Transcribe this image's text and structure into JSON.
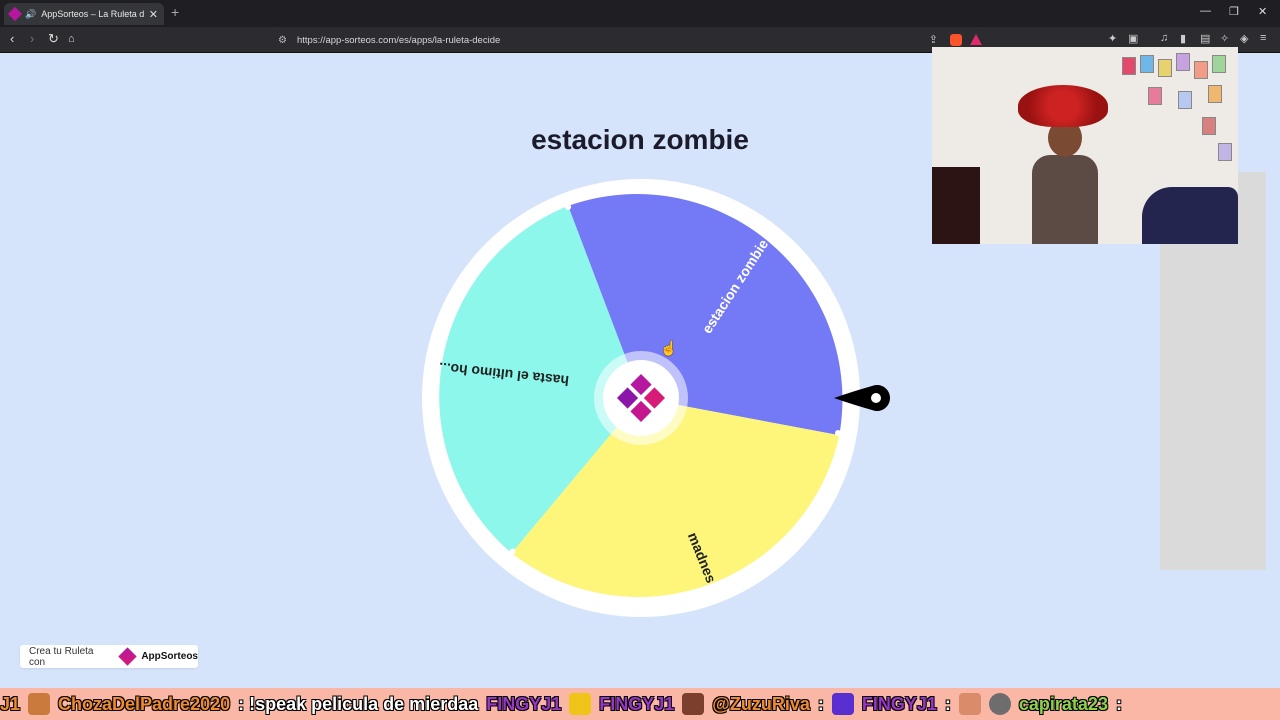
{
  "browser": {
    "tab_title": "AppSorteos – La Ruleta de la",
    "tab_audio_icon": "speaker-icon",
    "url": "https://app-sorteos.com/es/apps/la-ruleta-decide"
  },
  "page": {
    "title": "estacion zombie"
  },
  "wheel": {
    "segments": [
      {
        "label": "estacion zombie",
        "color": "#7479f5"
      },
      {
        "label": "madnes",
        "color": "#fdf67a"
      },
      {
        "label": "hasta el ultimo ho...",
        "color": "#8cf7ea"
      }
    ],
    "center_logo_color": "#b5179e"
  },
  "footer": {
    "text": "Crea tu Ruleta con",
    "brand": "AppSorteos"
  },
  "ticker": {
    "items": [
      {
        "text": "J1",
        "style": "orange"
      },
      {
        "text": "ChozaDelPadre2020",
        "style": "orange"
      },
      {
        "text": ": !speak pelicula de mierdaa",
        "style": "plain"
      },
      {
        "text": "FINGYJ1",
        "style": "purple"
      },
      {
        "text": "FINGYJ1",
        "style": "purple"
      },
      {
        "text": "@ZuzuRiva",
        "style": "orange"
      },
      {
        "text": ":",
        "style": "plain"
      },
      {
        "text": "FINGYJ1",
        "style": "purple"
      },
      {
        "text": ":",
        "style": "plain"
      },
      {
        "text": "capirata23",
        "style": "green"
      },
      {
        "text": ":",
        "style": "plain"
      }
    ]
  }
}
